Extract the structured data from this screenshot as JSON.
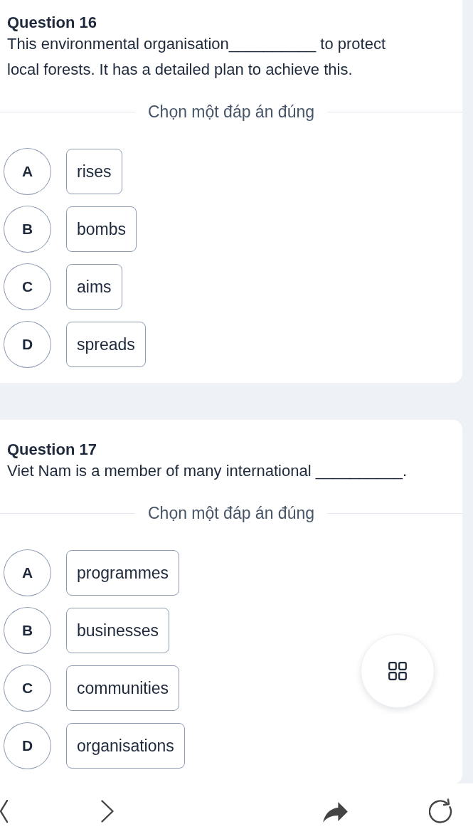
{
  "questions": [
    {
      "title": "Question 16",
      "text": "This environmental organisation__________ to protect local forests. It has a detailed plan to achieve this.",
      "instruction": "Chọn một đáp án đúng",
      "options": [
        {
          "letter": "A",
          "text": "rises",
          "selected": false
        },
        {
          "letter": "B",
          "text": "bombs",
          "selected": false
        },
        {
          "letter": "C",
          "text": "aims",
          "selected": false
        },
        {
          "letter": "D",
          "text": "spreads",
          "selected": false
        }
      ]
    },
    {
      "title": "Question 17",
      "text": "Viet Nam is a member of many international __________.",
      "instruction": "Chọn một đáp án đúng",
      "options": [
        {
          "letter": "A",
          "text": "programmes",
          "selected": false
        },
        {
          "letter": "B",
          "text": "businesses",
          "selected": false
        },
        {
          "letter": "C",
          "text": "communities",
          "selected": false
        },
        {
          "letter": "D",
          "text": "organisations",
          "selected": false
        }
      ]
    }
  ]
}
